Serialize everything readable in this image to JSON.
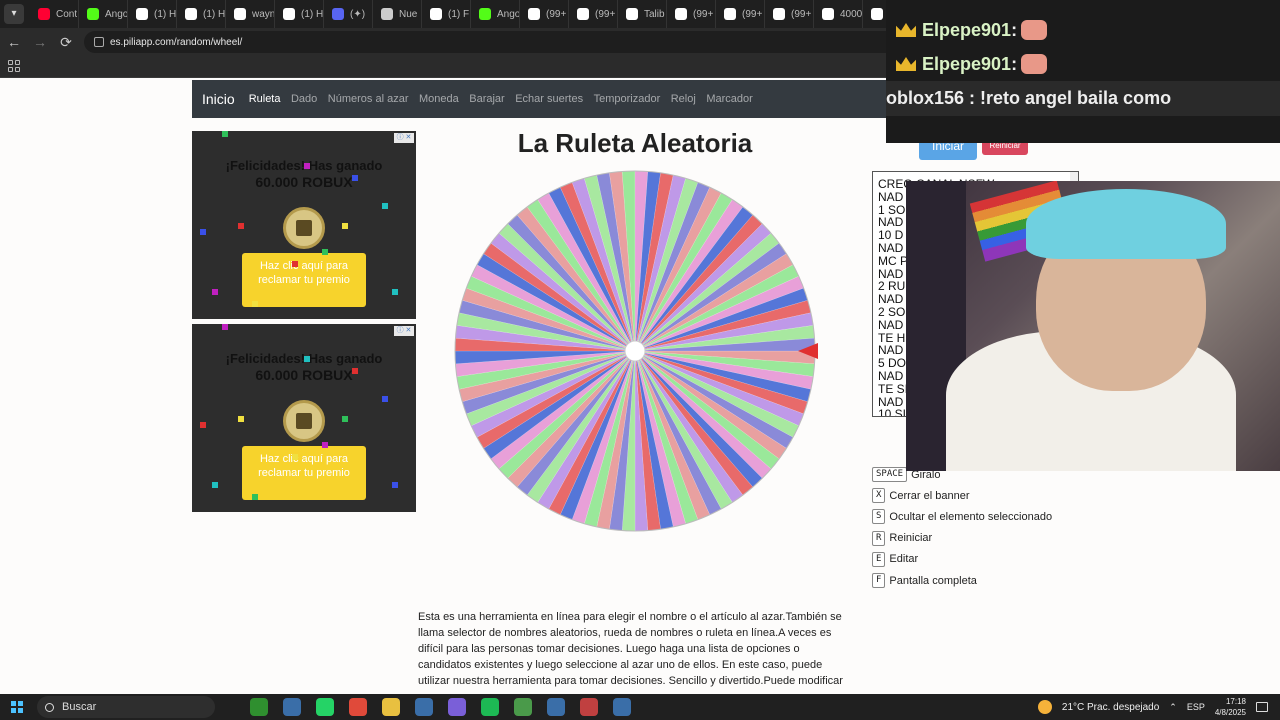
{
  "browser": {
    "tabs": [
      {
        "title": "Cont",
        "color": "#ff0033"
      },
      {
        "title": "Ango",
        "color": "#53fc18"
      },
      {
        "title": "(1) H",
        "color": "#ffffff"
      },
      {
        "title": "(1) H",
        "color": "#ffffff"
      },
      {
        "title": "wayn",
        "color": "#ffffff"
      },
      {
        "title": "(1) H",
        "color": "#ffffff"
      },
      {
        "title": "(✦)",
        "color": "#5865f2"
      },
      {
        "title": "Nue",
        "color": "#cccccc"
      },
      {
        "title": "(1) F",
        "color": "#ffffff"
      },
      {
        "title": "Ango",
        "color": "#53fc18"
      },
      {
        "title": "(99+",
        "color": "#ffffff"
      },
      {
        "title": "(99+",
        "color": "#ffffff"
      },
      {
        "title": "Talib",
        "color": "#ffffff"
      },
      {
        "title": "(99+",
        "color": "#ffffff"
      },
      {
        "title": "(99+",
        "color": "#ffffff"
      },
      {
        "title": "(99+",
        "color": "#ffffff"
      },
      {
        "title": "4000",
        "color": "#ffffff"
      },
      {
        "title": "(99+",
        "color": "#ffffff"
      }
    ],
    "url": "es.piliapp.com/random/wheel/",
    "back_icon": "arrow-left-icon",
    "forward_icon": "arrow-right-icon",
    "reload_icon": "reload-icon"
  },
  "site_nav": {
    "brand": "Inicio",
    "links": [
      "Ruleta",
      "Dado",
      "Números al azar",
      "Moneda",
      "Barajar",
      "Echar suertes",
      "Temporizador",
      "Reloj",
      "Marcador"
    ]
  },
  "ads": [
    {
      "line1": "¡Felicidades! Has ganado",
      "line2": "60.000 ROBUX",
      "button": "Haz clic aquí para reclamar tu premio"
    },
    {
      "line1": "¡Felicidades! Has ganado",
      "line2": "60.000 ROBUX",
      "button": "Haz clic aquí para reclamar tu premio"
    }
  ],
  "wheel": {
    "title": "La Ruleta Aleatoria",
    "segments": 88,
    "palette": [
      "#e8a0a0",
      "#9ae89a",
      "#e8a0d8",
      "#5576d8",
      "#e86a6a",
      "#bf99e8",
      "#a8e8a0",
      "#8a8ad8"
    ],
    "pointer_color": "#e03030"
  },
  "controls": {
    "spin_label": "Iniciar",
    "reset_label": "Reiniciar"
  },
  "names": [
    "CREO CANAL NSFW",
    "NAD",
    "1 SO",
    "NAD",
    "10 D",
    "NAD",
    "MC P",
    "NAD",
    "2 RU",
    "NAD",
    "2 SO",
    "NAD",
    "TE H",
    "NAD",
    "5 DO",
    "NAD",
    "TE SI",
    "NAD",
    "10 SI"
  ],
  "shortcuts": [
    {
      "key": "SPACE",
      "label": "Giralo"
    },
    {
      "key": "X",
      "label": "Cerrar el banner"
    },
    {
      "key": "S",
      "label": "Ocultar el elemento seleccionado"
    },
    {
      "key": "R",
      "label": "Reiniciar"
    },
    {
      "key": "E",
      "label": "Editar"
    },
    {
      "key": "F",
      "label": "Pantalla completa"
    }
  ],
  "description": "Esta es una herramienta en línea para elegir el nombre o el artículo al azar.También se llama selector de nombres aleatorios, rueda de nombres o ruleta en línea.A veces es difícil para las personas tomar decisiones. Luego haga una lista de opciones o candidatos existentes y luego seleccione al azar uno de ellos. En este caso, puede utilizar nuestra herramienta para tomar decisiones. Sencillo y divertido.Puede modificar los nombres en textarea, poner un",
  "chat": [
    {
      "user": "Elpepe901",
      "sep": " :"
    },
    {
      "user": "Elpepe901",
      "sep": " :"
    },
    {
      "text": "oblox156 : !reto angel baila como"
    }
  ],
  "taskbar": {
    "search_placeholder": "Buscar",
    "apps": [
      "#2f8f2f",
      "#3a6ea8",
      "#25d366",
      "#e04a3a",
      "#e8c040",
      "#3a6ea8",
      "#7a5fd8",
      "#1db954",
      "#4a9a4a",
      "#3a6ea8",
      "#c04040",
      "#3a6ea8"
    ],
    "weather": "21°C  Prac. despejado",
    "lang": "ESP",
    "time": "17:18",
    "date": "4/8/2025"
  }
}
